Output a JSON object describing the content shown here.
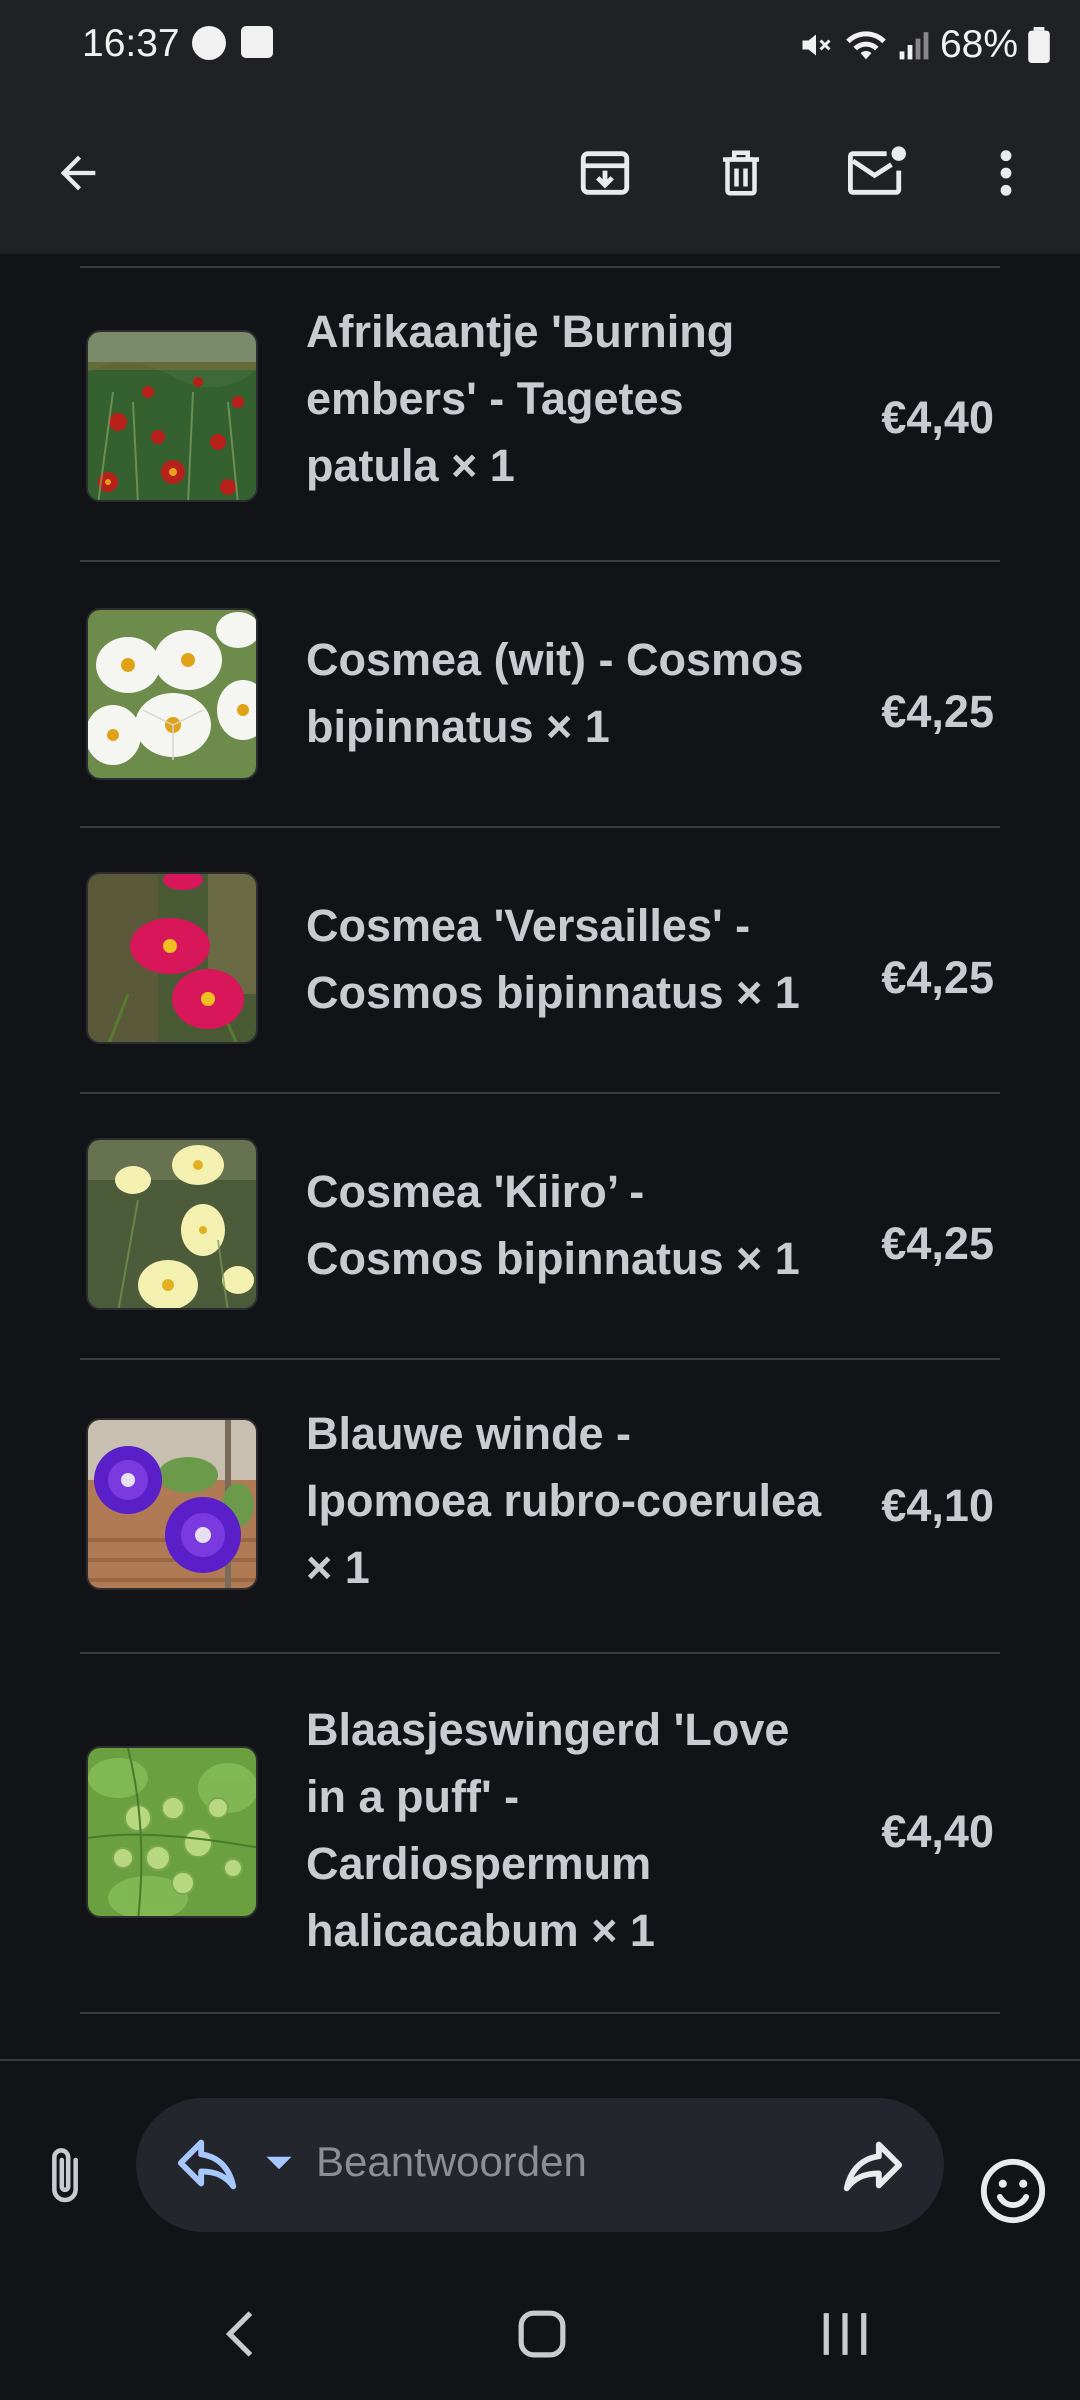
{
  "status_bar": {
    "time": "16:37",
    "battery": "68%"
  },
  "toolbar": {
    "back_icon": "arrow-back-icon",
    "archive_icon": "archive-icon",
    "delete_icon": "trash-icon",
    "mark_unread_icon": "mark-unread-icon",
    "more_icon": "more-vert-icon"
  },
  "order_items": [
    {
      "name": "Afrikaantje 'Burning embers' - Tagetes patula × 1",
      "price": "€4,40"
    },
    {
      "name": "Cosmea (wit) - Cosmos bipinnatus × 1",
      "price": "€4,25"
    },
    {
      "name": "Cosmea 'Versailles' - Cosmos bipinnatus × 1",
      "price": "€4,25"
    },
    {
      "name": "Cosmea 'Kiiro’ - Cosmos bipinnatus × 1",
      "price": "€4,25"
    },
    {
      "name": "Blauwe winde - Ipomoea rubro-coerulea × 1",
      "price": "€4,10"
    },
    {
      "name": "Blaasjeswingerd 'Love in a puff' - Cardiospermum halicacabum × 1",
      "price": "€4,40"
    }
  ],
  "reply_bar": {
    "placeholder": "Beantwoorden"
  },
  "colors": {
    "background": "#111317",
    "toolbar": "#202124",
    "text": "#c9cbd0",
    "pill": "#23262c"
  }
}
